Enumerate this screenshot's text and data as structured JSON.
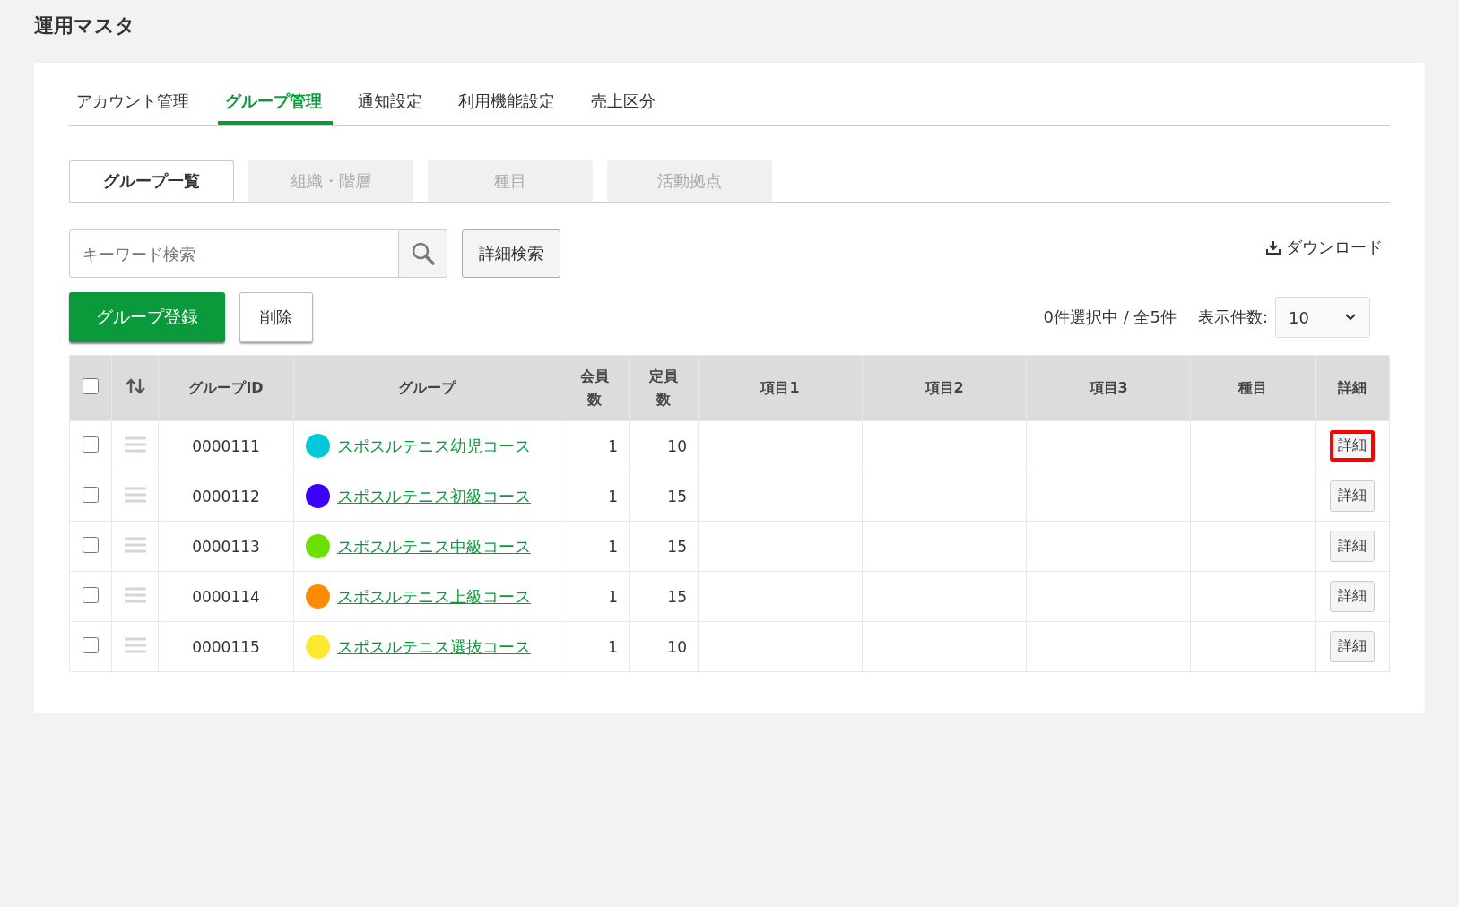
{
  "page_title": "運用マスタ",
  "tabs": [
    {
      "label": "アカウント管理",
      "selected": false
    },
    {
      "label": "グループ管理",
      "selected": true
    },
    {
      "label": "通知設定",
      "selected": false
    },
    {
      "label": "利用機能設定",
      "selected": false
    },
    {
      "label": "売上区分",
      "selected": false
    }
  ],
  "subtabs": [
    {
      "label": "グループ一覧",
      "selected": true
    },
    {
      "label": "組織・階層",
      "selected": false
    },
    {
      "label": "種目",
      "selected": false
    },
    {
      "label": "活動拠点",
      "selected": false
    }
  ],
  "search": {
    "placeholder": "キーワード検索"
  },
  "advanced_search_button": "詳細検索",
  "download_link": "ダウンロード",
  "register_button": "グループ登録",
  "delete_button": "削除",
  "selection_status": "0件選択中 / 全5件",
  "page_size": {
    "label": "表示件数:",
    "value": "10"
  },
  "table": {
    "columns": [
      "グループID",
      "グループ",
      "会員数",
      "定員数",
      "項目1",
      "項目2",
      "項目3",
      "種目",
      "詳細"
    ],
    "header_checked": false,
    "rows": [
      {
        "checked": false,
        "id": "0000111",
        "color": "#00c8d8",
        "group": "スポスルテニス幼児コース",
        "members": "1",
        "capacity": "10",
        "detail": "詳細",
        "highlighted": true
      },
      {
        "checked": false,
        "id": "0000112",
        "color": "#3c00ff",
        "group": "スポスルテニス初級コース",
        "members": "1",
        "capacity": "15",
        "detail": "詳細",
        "highlighted": false
      },
      {
        "checked": false,
        "id": "0000113",
        "color": "#6ee000",
        "group": "スポスルテニス中級コース",
        "members": "1",
        "capacity": "15",
        "detail": "詳細",
        "highlighted": false
      },
      {
        "checked": false,
        "id": "0000114",
        "color": "#ff8c00",
        "group": "スポスルテニス上級コース",
        "members": "1",
        "capacity": "15",
        "detail": "詳細",
        "highlighted": false
      },
      {
        "checked": false,
        "id": "0000115",
        "color": "#ffe830",
        "group": "スポスルテニス選抜コース",
        "members": "1",
        "capacity": "10",
        "detail": "詳細",
        "highlighted": false
      }
    ]
  }
}
